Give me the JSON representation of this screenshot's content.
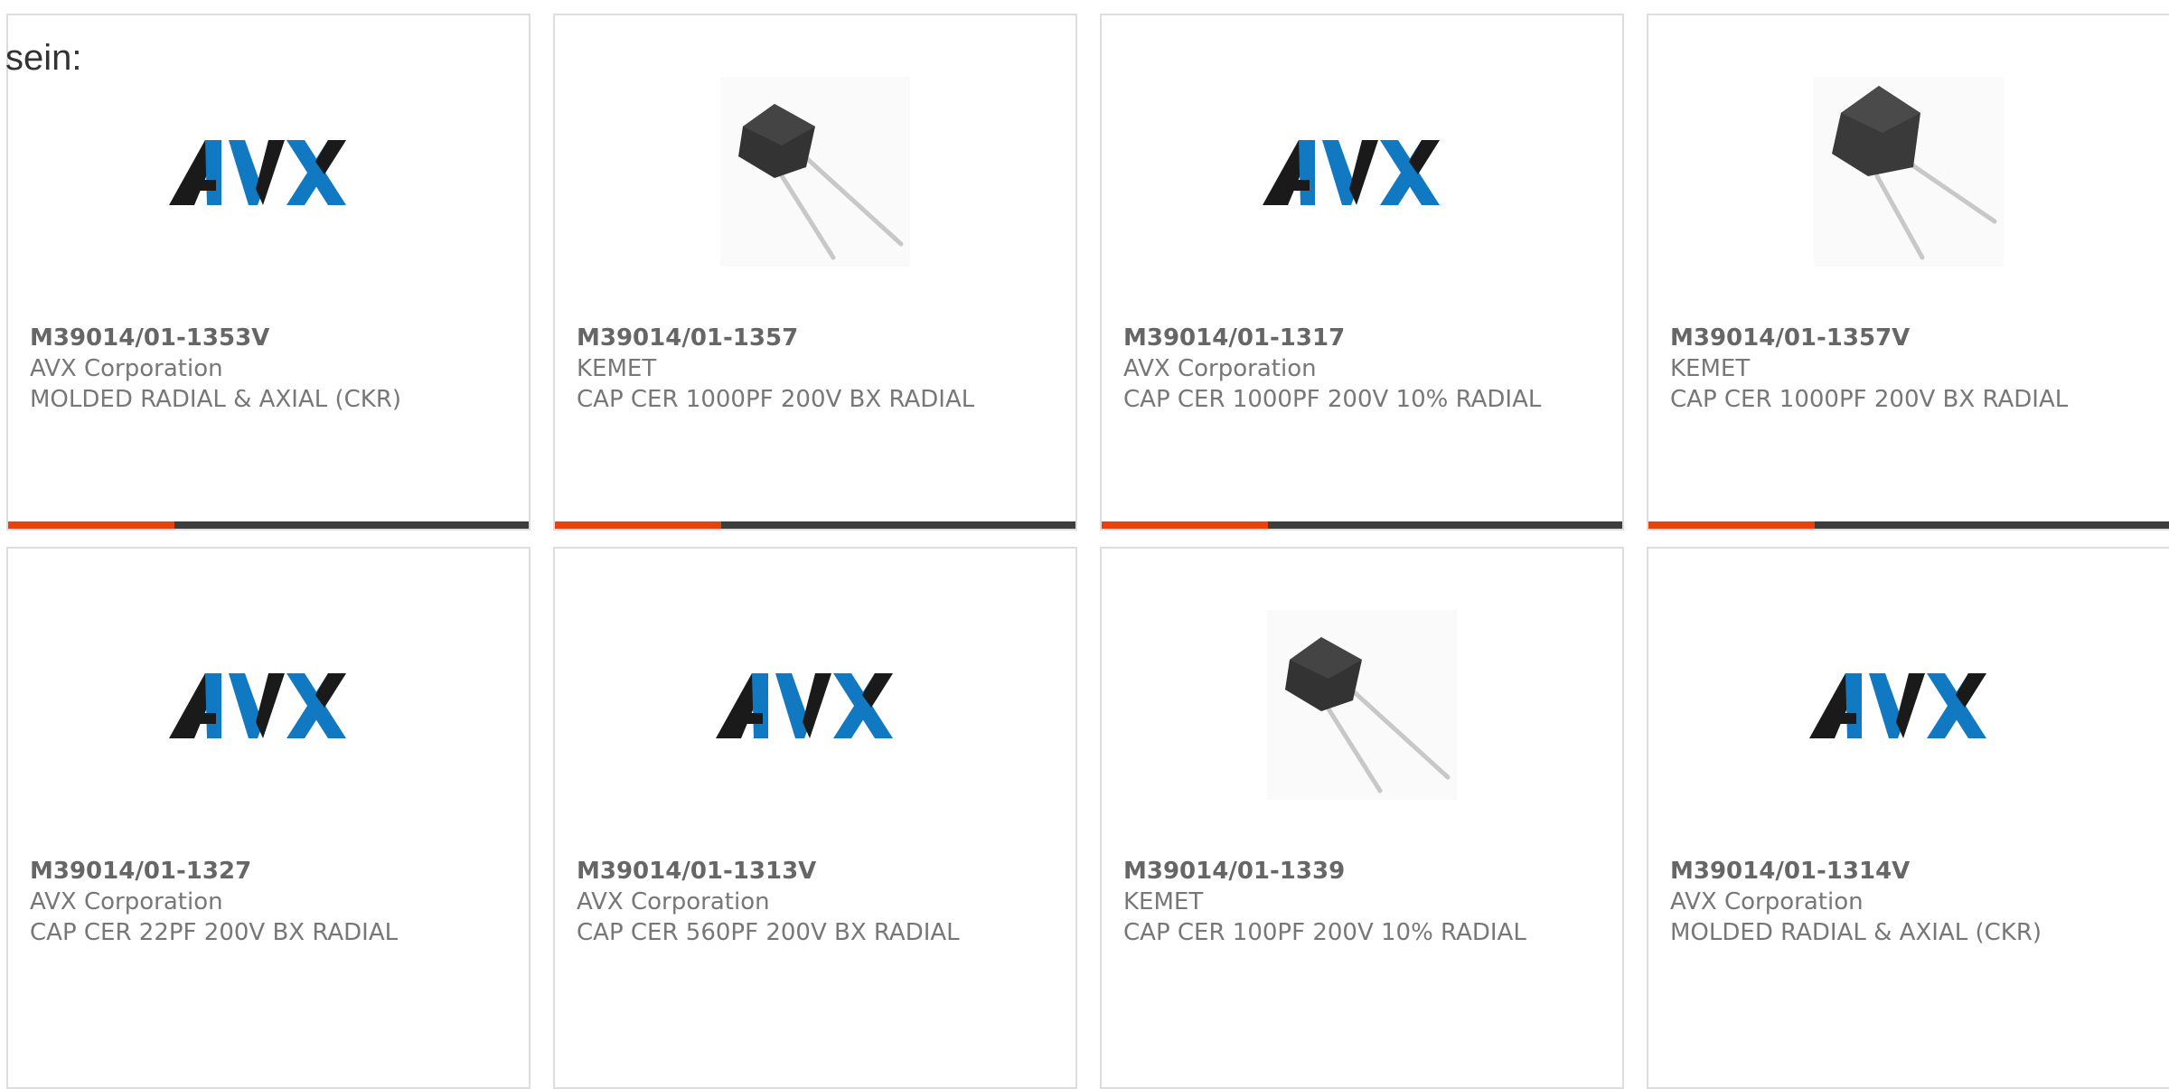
{
  "lead_text": "sein:",
  "colors": {
    "accent": "#e8420e",
    "bar_dark": "#3d3d3d",
    "avx_blue": "#1178c2",
    "avx_black": "#1a1a1a"
  },
  "progress_fraction": 0.32,
  "cards": [
    {
      "part": "M39014/01-1353V",
      "maker": "AVX Corporation",
      "desc": "MOLDED RADIAL & AXIAL (CKR)",
      "image": "avx-logo",
      "logo_text": "AVX"
    },
    {
      "part": "M39014/01-1357",
      "maker": "KEMET",
      "desc": "CAP CER 1000PF 200V BX RADIAL",
      "image": "radial-capacitor-photo"
    },
    {
      "part": "M39014/01-1317",
      "maker": "AVX Corporation",
      "desc": "CAP CER 1000PF 200V 10% RADIAL",
      "image": "avx-logo",
      "logo_text": "AVX"
    },
    {
      "part": "M39014/01-1357V",
      "maker": "KEMET",
      "desc": "CAP CER 1000PF 200V BX RADIAL",
      "image": "radial-capacitor-large-photo"
    },
    {
      "part": "M39014/01-1327",
      "maker": "AVX Corporation",
      "desc": "CAP CER 22PF 200V BX RADIAL",
      "image": "avx-logo",
      "logo_text": "AVX"
    },
    {
      "part": "M39014/01-1313V",
      "maker": "AVX Corporation",
      "desc": "CAP CER 560PF 200V BX RADIAL",
      "image": "avx-logo",
      "logo_text": "AVX"
    },
    {
      "part": "M39014/01-1339",
      "maker": "KEMET",
      "desc": "CAP CER 100PF 200V 10% RADIAL",
      "image": "radial-capacitor-photo"
    },
    {
      "part": "M39014/01-1314V",
      "maker": "AVX Corporation",
      "desc": "MOLDED RADIAL & AXIAL (CKR)",
      "image": "avx-logo",
      "logo_text": "AVX"
    }
  ]
}
